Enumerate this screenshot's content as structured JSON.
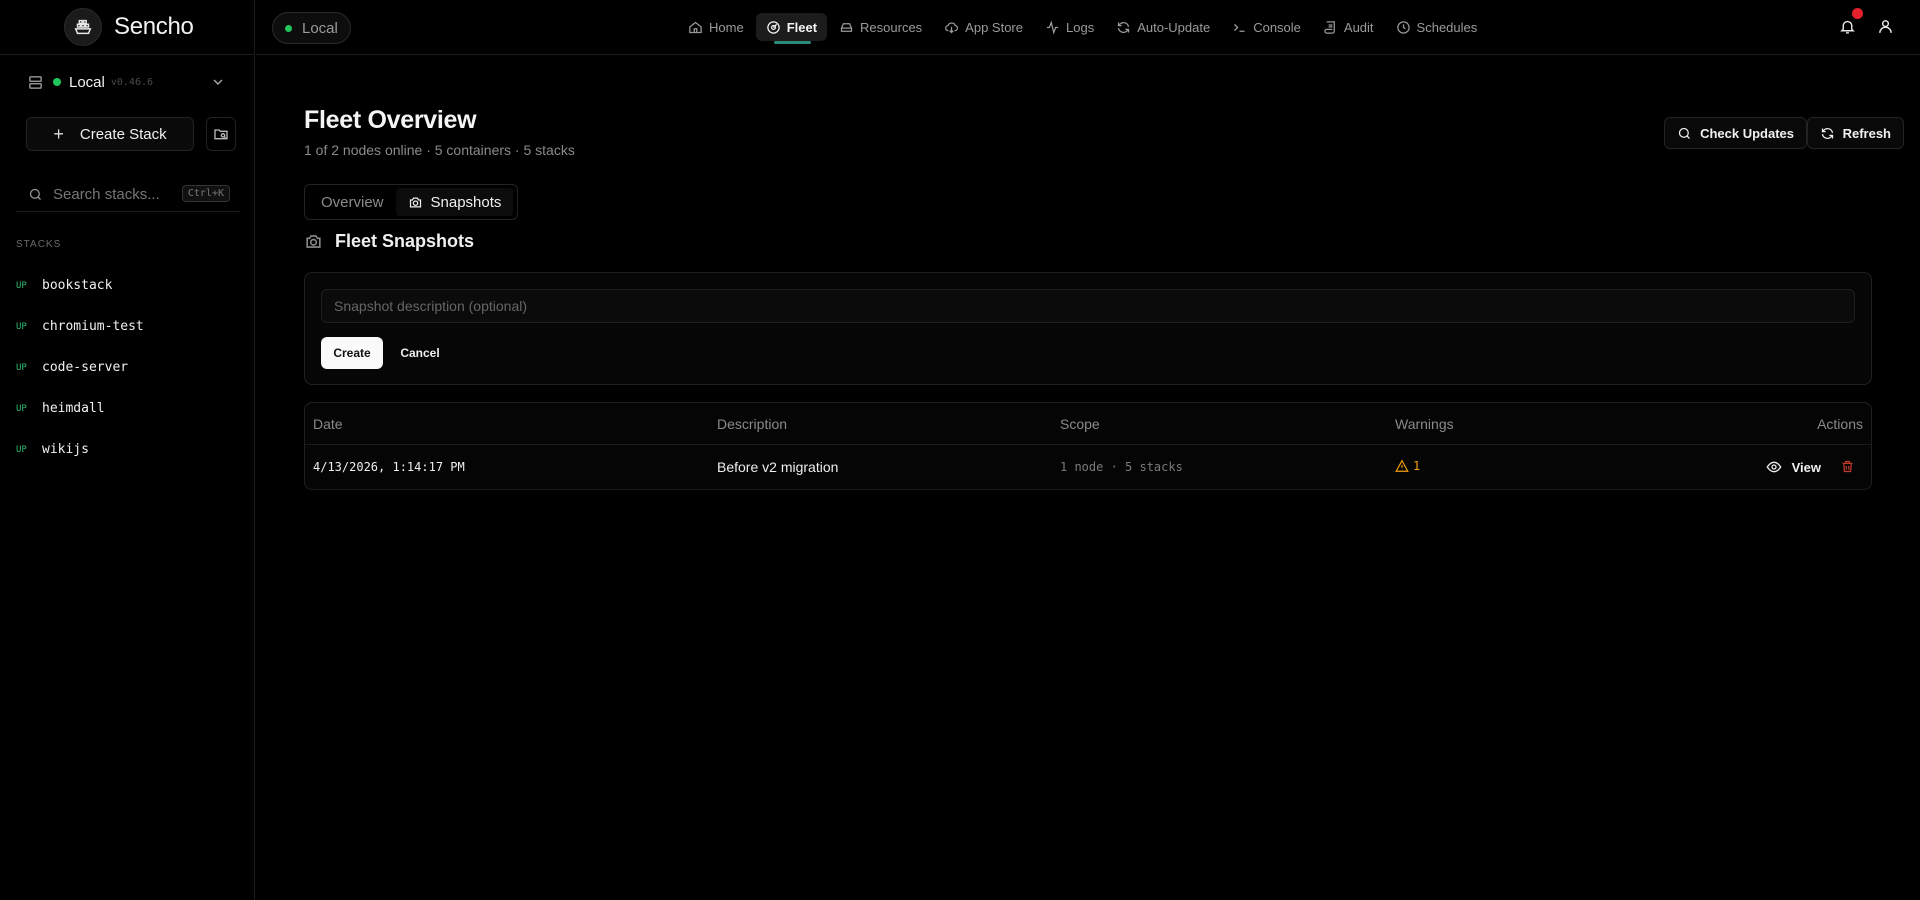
{
  "app": {
    "name": "Sencho"
  },
  "sidebar": {
    "node": {
      "name": "Local",
      "version": "v0.46.6"
    },
    "create_stack_label": "Create Stack",
    "search": {
      "placeholder": "Search stacks...",
      "shortcut": "Ctrl+K"
    },
    "stacks_label": "STACKS",
    "stacks": [
      {
        "status": "UP",
        "name": "bookstack"
      },
      {
        "status": "UP",
        "name": "chromium-test"
      },
      {
        "status": "UP",
        "name": "code-server"
      },
      {
        "status": "UP",
        "name": "heimdall"
      },
      {
        "status": "UP",
        "name": "wikijs"
      }
    ]
  },
  "topbar": {
    "environment": "Local",
    "nav": [
      {
        "label": "Home",
        "icon": "home-icon"
      },
      {
        "label": "Fleet",
        "icon": "fleet-icon",
        "active": true
      },
      {
        "label": "Resources",
        "icon": "hard-drive-icon"
      },
      {
        "label": "App Store",
        "icon": "cloud-download-icon"
      },
      {
        "label": "Logs",
        "icon": "activity-icon"
      },
      {
        "label": "Auto-Update",
        "icon": "refresh-icon"
      },
      {
        "label": "Console",
        "icon": "terminal-icon"
      },
      {
        "label": "Audit",
        "icon": "scroll-icon"
      },
      {
        "label": "Schedules",
        "icon": "clock-icon"
      }
    ]
  },
  "main": {
    "title": "Fleet Overview",
    "subtitle": "1 of 2 nodes online · 5 containers · 5 stacks",
    "check_updates_label": "Check Updates",
    "refresh_label": "Refresh",
    "tabs": [
      {
        "label": "Overview"
      },
      {
        "label": "Snapshots",
        "active": true
      }
    ],
    "section_title": "Fleet Snapshots",
    "form": {
      "description_placeholder": "Snapshot description (optional)",
      "description_value": "",
      "create_label": "Create",
      "cancel_label": "Cancel"
    },
    "table": {
      "headers": {
        "date": "Date",
        "description": "Description",
        "scope": "Scope",
        "warnings": "Warnings",
        "actions": "Actions"
      },
      "rows": [
        {
          "date": "4/13/2026, 1:14:17 PM",
          "description": "Before v2 migration",
          "scope": "1 node · 5 stacks",
          "warnings": "1",
          "view_label": "View"
        }
      ]
    }
  },
  "colors": {
    "accent": "#2c8a7a",
    "status_up": "#2fbf71",
    "warning": "#f59e0b",
    "danger": "#e5212e"
  }
}
